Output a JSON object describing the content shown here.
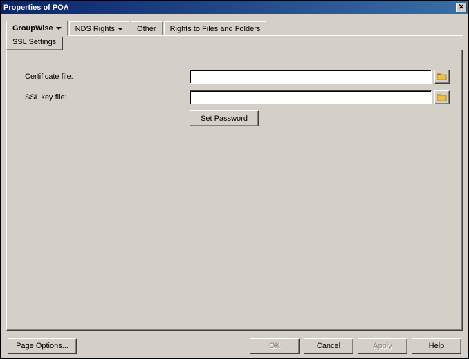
{
  "window": {
    "title": "Properties of POA"
  },
  "tabs": {
    "groupwise": "GroupWise",
    "nds": "NDS Rights",
    "other": "Other",
    "rights": "Rights to Files and Folders"
  },
  "subtab": {
    "ssl": "SSL Settings"
  },
  "form": {
    "cert_label": "Certificate file:",
    "sslkey_label": "SSL key file:",
    "cert_value": "",
    "sslkey_value": "",
    "set_password_prefix": "S",
    "set_password_rest": "et Password"
  },
  "buttons": {
    "page_options_prefix": "P",
    "page_options_rest": "age Options...",
    "ok": "OK",
    "cancel": "Cancel",
    "apply": "Apply",
    "help_prefix": "H",
    "help_rest": "elp"
  },
  "icons": {
    "close": "✕"
  }
}
